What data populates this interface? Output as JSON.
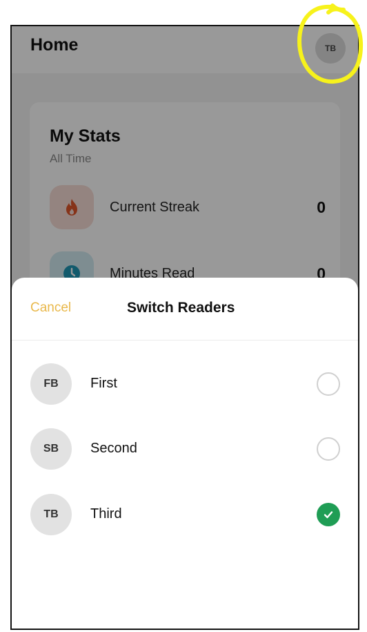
{
  "header": {
    "title": "Home",
    "avatar_initials": "TB"
  },
  "stats": {
    "title": "My Stats",
    "subtitle": "All Time",
    "items": [
      {
        "label": "Current Streak",
        "value": "0",
        "icon": "flame-icon",
        "color": "#e0552b",
        "bg": "#f7ddd5"
      },
      {
        "label": "Minutes Read",
        "value": "0",
        "icon": "clock-icon",
        "color": "#1f97b5",
        "bg": "#d3ecf2"
      }
    ]
  },
  "sheet": {
    "cancel_label": "Cancel",
    "title": "Switch Readers",
    "readers": [
      {
        "initials": "FB",
        "name": "First",
        "selected": false
      },
      {
        "initials": "SB",
        "name": "Second",
        "selected": false
      },
      {
        "initials": "TB",
        "name": "Third",
        "selected": true
      }
    ]
  },
  "colors": {
    "accent": "#e9b84a",
    "selected": "#1f9d55",
    "annotation": "#f7f21b"
  }
}
